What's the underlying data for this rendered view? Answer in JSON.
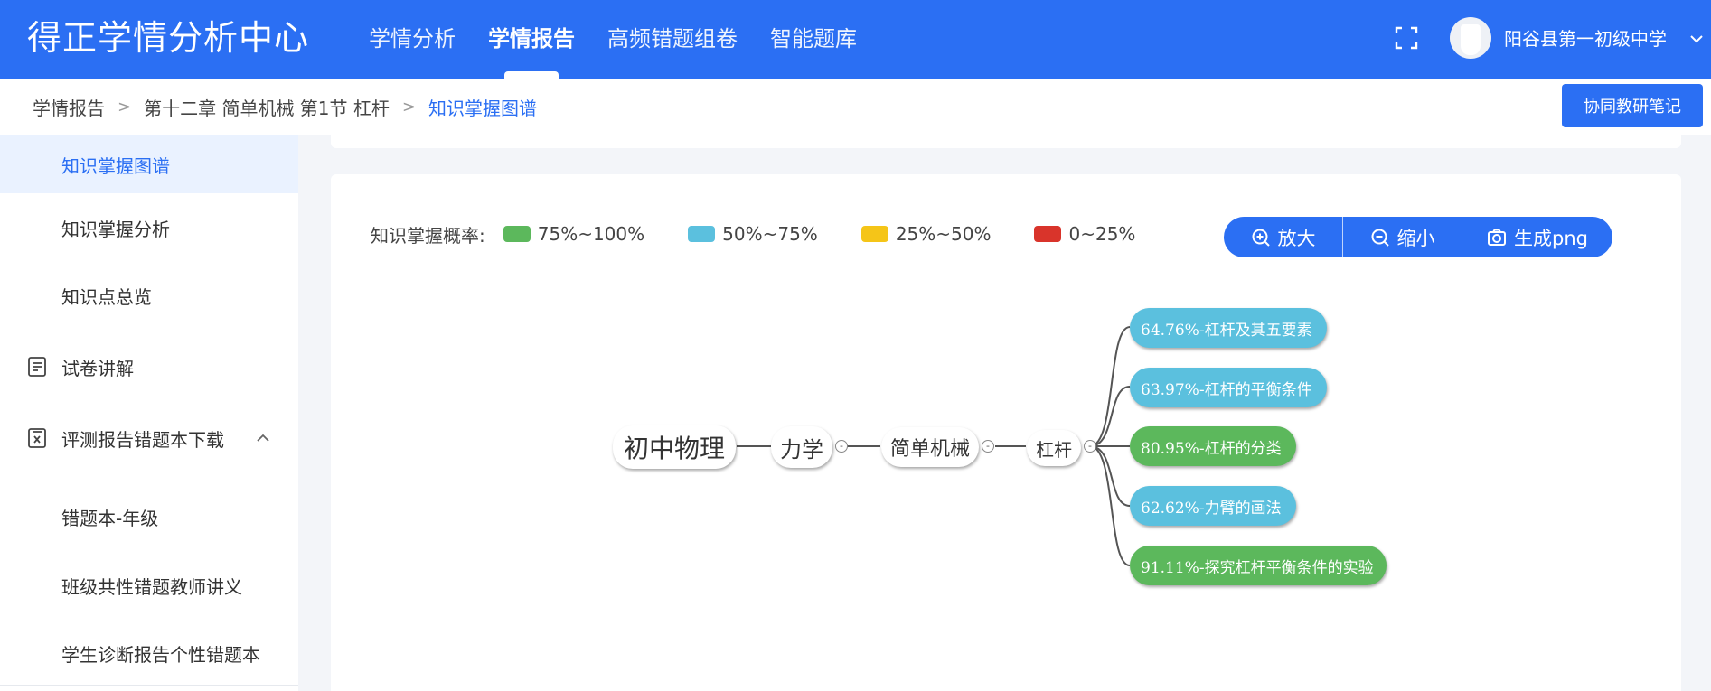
{
  "header": {
    "logo": "得正学情分析中心",
    "nav": [
      {
        "label": "学情分析",
        "active": false
      },
      {
        "label": "学情报告",
        "active": true
      },
      {
        "label": "高频错题组卷",
        "active": false
      },
      {
        "label": "智能题库",
        "active": false
      }
    ],
    "school": "阳谷县第一初级中学"
  },
  "breadcrumb": {
    "items": [
      "学情报告",
      "第十二章 简单机械 第1节 杠杆",
      "知识掌握图谱"
    ],
    "separator": ">"
  },
  "coop_button": "协同教研笔记",
  "sidebar": {
    "items": [
      {
        "label": "知识掌握图谱",
        "active": true
      },
      {
        "label": "知识掌握分析"
      },
      {
        "label": "知识点总览"
      },
      {
        "label": "试卷讲解",
        "icon": "document-icon"
      },
      {
        "label": "评测报告错题本下载",
        "icon": "document-x-icon",
        "expanded": true
      },
      {
        "label": "错题本-年级"
      },
      {
        "label": "班级共性错题教师讲义"
      },
      {
        "label": "学生诊断报告个性错题本"
      }
    ]
  },
  "legend": {
    "title": "知识掌握概率:",
    "items": [
      {
        "label": "75%~100%",
        "color": "#5cb85c"
      },
      {
        "label": "50%~75%",
        "color": "#5bc0de"
      },
      {
        "label": "25%~50%",
        "color": "#f5c518"
      },
      {
        "label": "0~25%",
        "color": "#d9342b"
      }
    ]
  },
  "toolbar": {
    "zoom_in": "放大",
    "zoom_out": "缩小",
    "export": "生成png"
  },
  "mindmap": {
    "root": "初中物理",
    "level1": "力学",
    "level2": "简单机械",
    "level3": "杠杆",
    "collapse_symbol": "-",
    "leaves": [
      {
        "label": "64.76%-杠杆及其五要素",
        "color": "#5bc0de"
      },
      {
        "label": "63.97%-杠杆的平衡条件",
        "color": "#5bc0de"
      },
      {
        "label": "80.95%-杠杆的分类",
        "color": "#5cb85c"
      },
      {
        "label": "62.62%-力臂的画法",
        "color": "#5bc0de"
      },
      {
        "label": "91.11%-探究杠杆平衡条件的实验",
        "color": "#5cb85c"
      }
    ]
  }
}
